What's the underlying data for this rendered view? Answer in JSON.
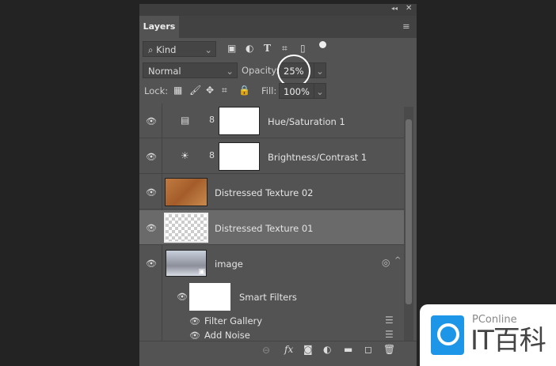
{
  "panel": {
    "title": "Layers",
    "collapse_icon": "double-chevron",
    "close_icon": "x",
    "menu_icon": "hamburger"
  },
  "filter": {
    "kind_label": "Kind"
  },
  "blend": {
    "mode": "Normal",
    "opacity_label": "Opacity:",
    "opacity_value": "25%",
    "lock_label": "Lock:",
    "fill_label": "Fill:",
    "fill_value": "100%"
  },
  "layers": [
    {
      "name": "Hue/Saturation 1",
      "type": "adjustment"
    },
    {
      "name": "Brightness/Contrast 1",
      "type": "adjustment"
    },
    {
      "name": "Distressed Texture 02",
      "type": "pixel"
    },
    {
      "name": "Distressed Texture 01",
      "type": "pixel",
      "selected": true
    },
    {
      "name": "image",
      "type": "smart-object"
    }
  ],
  "smart_filters": {
    "label": "Smart Filters",
    "items": [
      "Filter Gallery",
      "Add Noise"
    ]
  },
  "watermark": {
    "brand": "PConline",
    "name": "IT百科"
  },
  "colors": {
    "panel": "#535353",
    "selected": "#6a6a6a",
    "texture": "#b8703a",
    "watermark_blue": "#1e96e8"
  }
}
